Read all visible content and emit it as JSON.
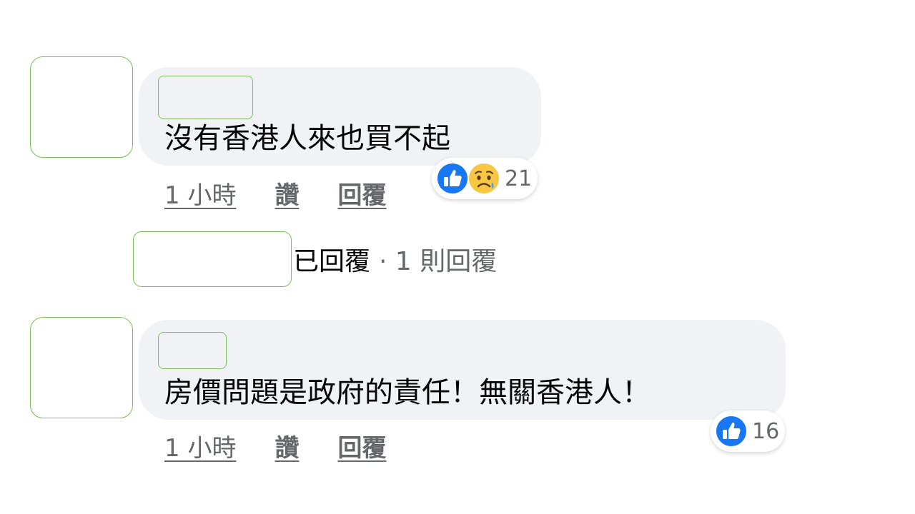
{
  "comments": [
    {
      "text": "沒有香港人來也買不起",
      "time": "1 小時",
      "like_label": "讚",
      "reply_label": "回覆",
      "reactions": {
        "icons": [
          "like-icon",
          "sad-icon"
        ],
        "count": "21"
      },
      "replies": {
        "label": "已回覆",
        "count": "· 1 則回覆"
      }
    },
    {
      "text": "房價問題是政府的責任！無關香港人！",
      "time": "1 小時",
      "like_label": "讚",
      "reply_label": "回覆",
      "reactions": {
        "icons": [
          "like-icon"
        ],
        "count": "16"
      }
    }
  ],
  "colors": {
    "bubble": "#f0f2f5",
    "like_blue": "#1877f2",
    "meta_gray": "#65676b",
    "placeholder_border": "#7cbf5a"
  }
}
